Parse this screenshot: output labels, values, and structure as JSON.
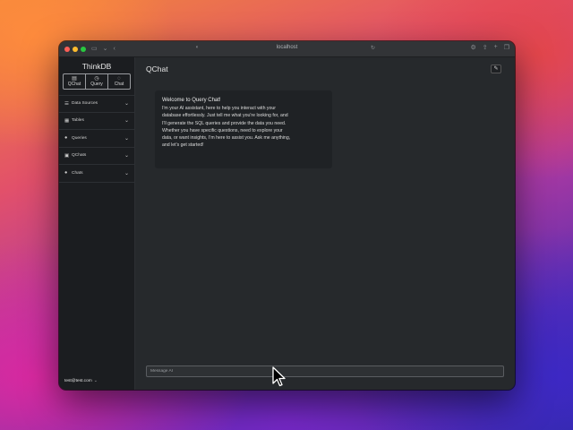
{
  "browser": {
    "url": "localhost"
  },
  "sidebar": {
    "brand": "ThinkDB",
    "modes": [
      {
        "label": "QChat",
        "icon": "chat-lines-icon"
      },
      {
        "label": "Query",
        "icon": "clock-icon"
      },
      {
        "label": "Chat",
        "icon": "chat-bubble-icon"
      }
    ],
    "items": [
      {
        "label": "Data Sources",
        "icon": "database-icon"
      },
      {
        "label": "Tables",
        "icon": "table-icon"
      },
      {
        "label": "Queries",
        "icon": "query-icon"
      },
      {
        "label": "QChats",
        "icon": "chat-history-icon"
      },
      {
        "label": "Chats",
        "icon": "chat-bubble-icon"
      }
    ],
    "user": "test@test.com"
  },
  "main": {
    "title": "QChat",
    "message": {
      "heading": "Welcome to Query Chat!",
      "lines": [
        "I'm your AI assistant, here to help you interact with your",
        "database effortlessly. Just tell me what you're looking for, and",
        "I'll generate the SQL queries and provide the data you need.",
        "Whether you have specific questions, need to explore your",
        "data, or want insights, I'm here to assist you. Ask me anything,",
        "and let's get started!"
      ]
    },
    "input_placeholder": "Message AI"
  }
}
